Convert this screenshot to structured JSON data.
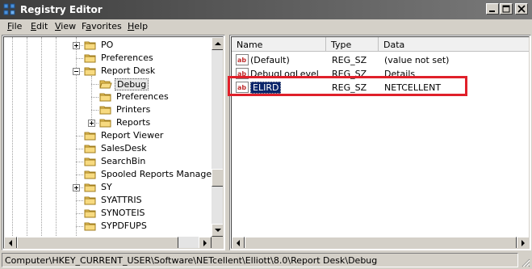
{
  "window": {
    "title": "Registry Editor",
    "titlebar_colors": {
      "start": "#3d3d3d",
      "end": "#7a7a7a"
    },
    "controls": {
      "minimize": "minimize-icon",
      "maximize": "maximize-icon",
      "close": "close-icon"
    }
  },
  "menu": {
    "file": {
      "u": "F",
      "rest": "ile"
    },
    "edit": {
      "u": "E",
      "rest": "dit"
    },
    "view": {
      "u": "V",
      "rest": "iew"
    },
    "favorites": {
      "pre": "F",
      "u": "a",
      "rest": "vorites"
    },
    "help": {
      "u": "H",
      "rest": "elp"
    }
  },
  "tree": {
    "items": [
      {
        "label": "PO",
        "expander": "plus"
      },
      {
        "label": "Preferences",
        "expander": "none"
      },
      {
        "label": "Report Desk",
        "expander": "minus"
      },
      {
        "label": "Debug",
        "expander": "none",
        "selected": true
      },
      {
        "label": "Preferences",
        "expander": "none"
      },
      {
        "label": "Printers",
        "expander": "none"
      },
      {
        "label": "Reports",
        "expander": "plus"
      },
      {
        "label": "Report Viewer",
        "expander": "none"
      },
      {
        "label": "SalesDesk",
        "expander": "none"
      },
      {
        "label": "SearchBin",
        "expander": "none"
      },
      {
        "label": "Spooled Reports Manager",
        "expander": "none"
      },
      {
        "label": "SY",
        "expander": "plus"
      },
      {
        "label": "SYATTRIS",
        "expander": "none"
      },
      {
        "label": "SYNOTEIS",
        "expander": "none"
      },
      {
        "label": "SYPDFUPS",
        "expander": "none"
      }
    ]
  },
  "list": {
    "columns": {
      "name": "Name",
      "type": "Type",
      "data": "Data"
    },
    "rows": [
      {
        "name": "(Default)",
        "type": "REG_SZ",
        "data": "(value not set)"
      },
      {
        "name": "DebugLogLevel",
        "type": "REG_SZ",
        "data": "Details"
      },
      {
        "name": "ELIRD",
        "type": "REG_SZ",
        "data": "NETCELLENT",
        "selected": true
      }
    ],
    "highlight_color": "#e0202a",
    "selection_color": "#0a246a"
  },
  "status": {
    "path": "Computer\\HKEY_CURRENT_USER\\Software\\NETcellent\\Elliott\\8.0\\Report Desk\\Debug"
  }
}
